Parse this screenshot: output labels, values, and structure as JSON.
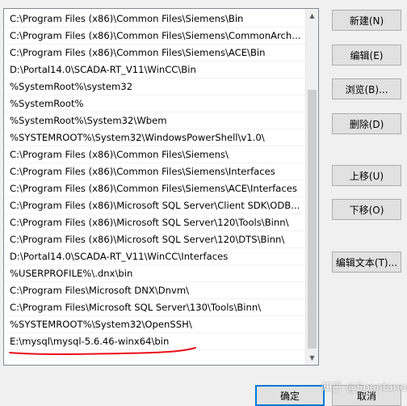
{
  "path_list": [
    "C:\\Program Files (x86)\\Common Files\\Siemens\\Bin",
    "C:\\Program Files (x86)\\Common Files\\Siemens\\CommonArch...",
    "C:\\Program Files (x86)\\Common Files\\Siemens\\ACE\\Bin",
    "D:\\Portal14.0\\SCADA-RT_V11\\WinCC\\Bin",
    "%SystemRoot%\\system32",
    "%SystemRoot%",
    "%SystemRoot%\\System32\\Wbem",
    "%SYSTEMROOT%\\System32\\WindowsPowerShell\\v1.0\\",
    "C:\\Program Files (x86)\\Common Files\\Siemens\\",
    "C:\\Program Files (x86)\\Common Files\\Siemens\\Interfaces",
    "C:\\Program Files (x86)\\Common Files\\Siemens\\ACE\\Interfaces",
    "C:\\Program Files (x86)\\Microsoft SQL Server\\Client SDK\\ODB...",
    "C:\\Program Files (x86)\\Microsoft SQL Server\\120\\Tools\\Binn\\",
    "C:\\Program Files (x86)\\Microsoft SQL Server\\120\\DTS\\Binn\\",
    "D:\\Portal14.0\\SCADA-RT_V11\\WinCC\\Interfaces",
    "%USERPROFILE%\\.dnx\\bin",
    "C:\\Program Files\\Microsoft DNX\\Dnvm\\",
    "C:\\Program Files\\Microsoft SQL Server\\130\\Tools\\Binn\\",
    "%SYSTEMROOT%\\System32\\OpenSSH\\",
    "E:\\mysql\\mysql-5.6.46-winx64\\bin"
  ],
  "buttons": {
    "new": "新建(N)",
    "edit": "编辑(E)",
    "browse": "浏览(B)...",
    "delete": "删除(D)",
    "move_up": "上移(U)",
    "move_down": "下移(O)",
    "edit_text": "编辑文本(T)...",
    "ok": "确定",
    "cancel": "取消"
  },
  "watermark": "知乎 @Spontaneous",
  "colors": {
    "annotation_underline": "#e8101a",
    "ok_border": "#0078d7"
  },
  "icons": {
    "scroll_up": "triangle-up",
    "scroll_down": "triangle-down"
  }
}
